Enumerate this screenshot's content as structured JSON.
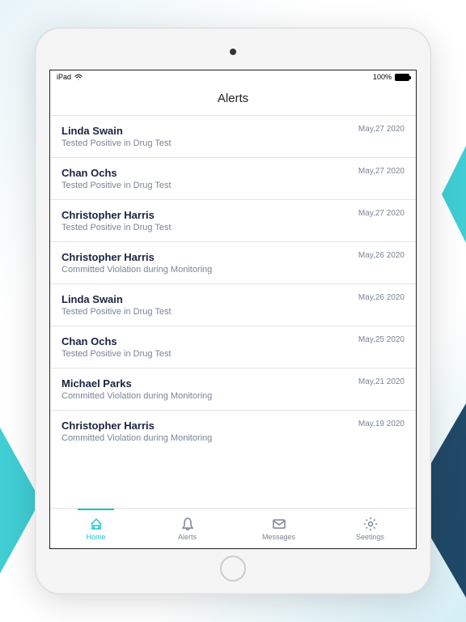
{
  "status": {
    "device": "iPad",
    "battery": "100%"
  },
  "header": {
    "title": "Alerts"
  },
  "alerts": [
    {
      "name": "Linda Swain",
      "desc": "Tested Positive in Drug Test",
      "date": "May,27 2020"
    },
    {
      "name": "Chan Ochs",
      "desc": "Tested Positive in Drug Test",
      "date": "May,27 2020"
    },
    {
      "name": "Christopher Harris",
      "desc": "Tested Positive in Drug Test",
      "date": "May,27 2020"
    },
    {
      "name": "Christopher Harris",
      "desc": "Committed Violation during Monitoring",
      "date": "May,26 2020"
    },
    {
      "name": "Linda Swain",
      "desc": "Tested Positive in Drug Test",
      "date": "May,26 2020"
    },
    {
      "name": "Chan Ochs",
      "desc": "Tested Positive in Drug Test",
      "date": "May,25 2020"
    },
    {
      "name": "Michael Parks",
      "desc": "Committed Violation during Monitoring",
      "date": "May,21 2020"
    },
    {
      "name": "Christopher Harris",
      "desc": "Committed Violation during Monitoring",
      "date": "May,19 2020"
    }
  ],
  "tabs": [
    {
      "label": "Home",
      "active": true
    },
    {
      "label": "Alerts",
      "active": false
    },
    {
      "label": "Messages",
      "active": false
    },
    {
      "label": "Seetings",
      "active": false
    }
  ]
}
